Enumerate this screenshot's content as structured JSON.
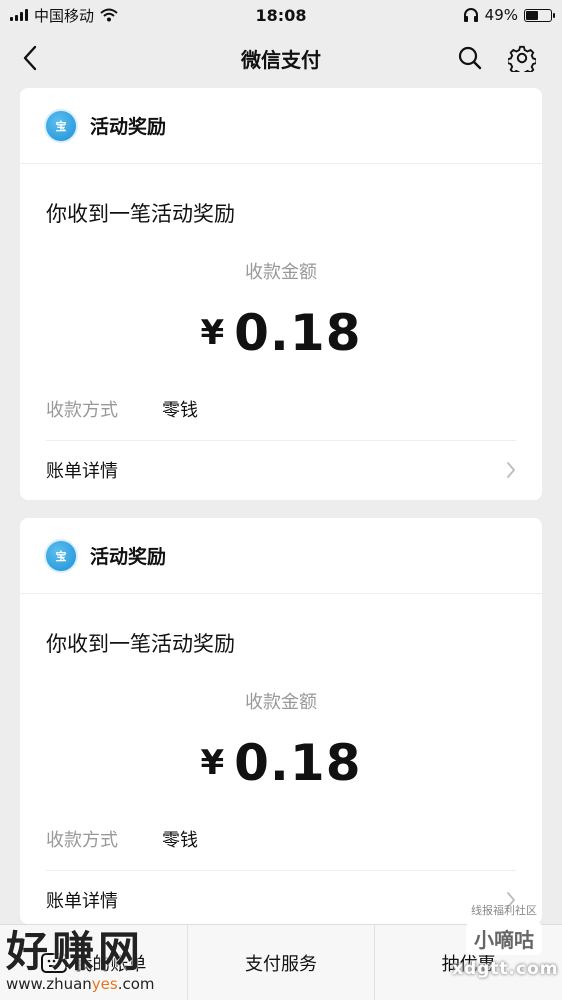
{
  "status_bar": {
    "carrier": "中国移动",
    "time": "18:08",
    "battery": "49%",
    "battery_level": 0.49
  },
  "nav": {
    "title": "微信支付",
    "back_icon": "chevron-left-icon",
    "search_icon": "search-icon",
    "settings_icon": "gear-icon"
  },
  "cards": [
    {
      "app_name": "活动奖励",
      "logo_text": "宝",
      "title": "你收到一笔活动奖励",
      "amount_label": "收款金额",
      "currency": "¥",
      "amount": "0.18",
      "method_label": "收款方式",
      "method_value": "零钱",
      "details_label": "账单详情"
    },
    {
      "app_name": "活动奖励",
      "logo_text": "宝",
      "title": "你收到一笔活动奖励",
      "amount_label": "收款金额",
      "currency": "¥",
      "amount": "0.18",
      "method_label": "收款方式",
      "method_value": "零钱",
      "details_label": "账单详情"
    }
  ],
  "bottom_bar": {
    "items": [
      "我的账单",
      "支付服务",
      "抽优惠"
    ]
  },
  "watermarks": {
    "left_big": "好赚网",
    "left_url_pre": "www.zhuan",
    "left_url_accent": "yes",
    "left_url_post": ".com",
    "right_top": "线报福利社区",
    "right_logo": "小嘀咕",
    "right_url": "xdgtt.com"
  }
}
